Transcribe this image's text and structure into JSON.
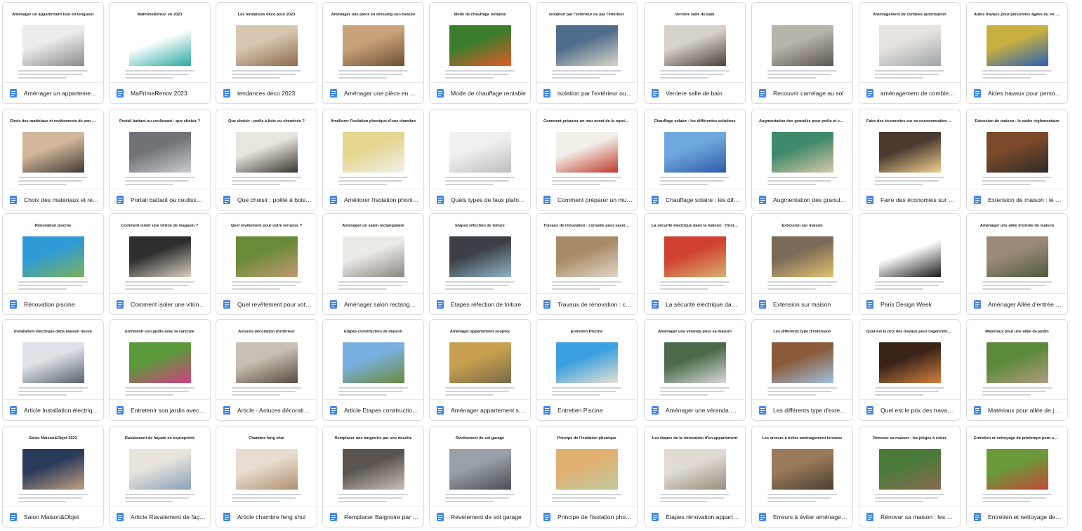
{
  "documents": [
    {
      "name": "Aménager un appartement t...",
      "preview_title": "Aménager un appartement tout en longueur",
      "colors": [
        "#ececec",
        "#8a8a8a"
      ]
    },
    {
      "name": "MaPrimeRenov 2023",
      "preview_title": "MaPrimeRénov' en 2023",
      "colors": [
        "#ffffff",
        "#2aa8a0"
      ]
    },
    {
      "name": "tendances deco 2023",
      "preview_title": "Les tendances déco pour 2023",
      "colors": [
        "#d8c7b0",
        "#8b6b4e"
      ]
    },
    {
      "name": "Aménager une pièce en dres...",
      "preview_title": "Aménager une pièce en dressing sur-mesure",
      "colors": [
        "#c9a27a",
        "#6e4f34"
      ]
    },
    {
      "name": "Mode de chauffage rentable",
      "preview_title": "Mode de chauffage rentable",
      "colors": [
        "#3a7d2c",
        "#e25b2a"
      ]
    },
    {
      "name": "isolation par l'extérieur ou pa...",
      "preview_title": "Isolation par l'extérieur ou par l'intérieur",
      "colors": [
        "#4f6d8a",
        "#d9d4c8"
      ]
    },
    {
      "name": "Verriere salle de bain",
      "preview_title": "Verrière salle de bain",
      "colors": [
        "#d7d2cb",
        "#4a4038"
      ]
    },
    {
      "name": "Recouvrir carrelage au sol",
      "preview_title": "",
      "colors": [
        "#b8b3ab",
        "#5c5650"
      ]
    },
    {
      "name": "aménagement de combles a...",
      "preview_title": "Aménagement de combles autorisation",
      "colors": [
        "#e6e3de",
        "#9ea3a8"
      ]
    },
    {
      "name": "Aides travaux pour personne...",
      "preview_title": "Aides travaux pour personnes âgées ou en situation de handicap",
      "colors": [
        "#c8b040",
        "#2a5fb0"
      ]
    },
    {
      "name": "Choix des matériaux et revêt...",
      "preview_title": "Choix des matériaux et revêtements de son escalier",
      "colors": [
        "#d2b89a",
        "#403a36"
      ]
    },
    {
      "name": "Portail battant ou coulissant ...",
      "preview_title": "Portail battant ou coulissant : que choisir ?",
      "colors": [
        "#6f7378",
        "#c9ccd0"
      ]
    },
    {
      "name": "Que choisir : poêle à bois ou ...",
      "preview_title": "Que choisir : poêle à bois ou cheminée ?",
      "colors": [
        "#e8e4de",
        "#3b3430"
      ]
    },
    {
      "name": "Améliorer l'isolation phoniqu...",
      "preview_title": "Améliorer l'isolation phonique d'une chambre",
      "colors": [
        "#e4d690",
        "#f2f0ea"
      ]
    },
    {
      "name": "Quels types de faux plafond ...",
      "preview_title": "",
      "colors": [
        "#f0f0f0",
        "#bdbdbd"
      ]
    },
    {
      "name": "Comment préparer un mur a...",
      "preview_title": "Comment préparer un mur avant de le repeindre ?",
      "colors": [
        "#f2efe9",
        "#c0392b"
      ]
    },
    {
      "name": "Chauffage solaire : les différ...",
      "preview_title": "Chauffage solaire : les différentes solutions",
      "colors": [
        "#6fa8dc",
        "#2e5aa8"
      ]
    },
    {
      "name": "Augmentation des granulés ...",
      "preview_title": "Augmentation des granulés pour poêle et chaudière",
      "colors": [
        "#3f8a6a",
        "#d9c8a8"
      ]
    },
    {
      "name": "Faire des économies sur sa c...",
      "preview_title": "Faire des économies sur sa consommation électrique",
      "colors": [
        "#4a3a30",
        "#f0d090"
      ]
    },
    {
      "name": "Extension de maison : le cad...",
      "preview_title": "Extension de maison : le cadre réglementaire",
      "colors": [
        "#7a4a2a",
        "#2e2a28"
      ]
    },
    {
      "name": "Rénovation piscine",
      "preview_title": "Rénovation piscine",
      "colors": [
        "#2f9ad6",
        "#7bb35a"
      ]
    },
    {
      "name": "Comment isoler une vitrine d...",
      "preview_title": "Comment isoler une vitrine de magasin ?",
      "colors": [
        "#2e2e2e",
        "#d8d0c0"
      ]
    },
    {
      "name": "Quel revêtement pour votre t...",
      "preview_title": "Quel revêtement pour votre terrasse ?",
      "colors": [
        "#6a8a3a",
        "#c09a70"
      ]
    },
    {
      "name": "Aménager salon rectangulaire",
      "preview_title": "Aménager un salon rectangulaire",
      "colors": [
        "#ecebe8",
        "#8c8680"
      ]
    },
    {
      "name": "Etapes réfection de toiture",
      "preview_title": "Étapes réfection de toiture",
      "colors": [
        "#3c4046",
        "#8fb3c8"
      ]
    },
    {
      "name": "Travaux de rénovation : cons...",
      "preview_title": "Travaux de rénovation : conseils pour savoir par quoi commencer",
      "colors": [
        "#a88a66",
        "#e0d6c8"
      ]
    },
    {
      "name": "La sécurité électrique dans l...",
      "preview_title": "La sécurité électrique dans la maison : l'installation électrique",
      "colors": [
        "#d04030",
        "#d8b070"
      ]
    },
    {
      "name": "Extension sur maison",
      "preview_title": "Extension sur maison",
      "colors": [
        "#7a6a58",
        "#e0c070"
      ]
    },
    {
      "name": "Paris Design Week",
      "preview_title": "",
      "colors": [
        "#ffffff",
        "#1a1a1a"
      ]
    },
    {
      "name": "Aménager Allée d'entrée de ...",
      "preview_title": "Aménager une allée d'entrée de maison",
      "colors": [
        "#9a8a78",
        "#4e5a3a"
      ]
    },
    {
      "name": "Article Installation électrique...",
      "preview_title": "Installation électrique dans maison neuve",
      "colors": [
        "#dfe3e8",
        "#5a6270"
      ]
    },
    {
      "name": "Entretenir son jardin avec la ...",
      "preview_title": "Entretenir son jardin avec la canicule",
      "colors": [
        "#5a9a3a",
        "#d04080"
      ]
    },
    {
      "name": "Article - Astuces décoration ...",
      "preview_title": "Astuces décoration d'intérieur",
      "colors": [
        "#c8c0b4",
        "#5a4a3e"
      ]
    },
    {
      "name": "Article Etapes construction d...",
      "preview_title": "Étapes construction de maison",
      "colors": [
        "#7ab0e0",
        "#6a8a3a"
      ]
    },
    {
      "name": "Aménager appartement sou...",
      "preview_title": "Aménager appartement souplex",
      "colors": [
        "#c8a050",
        "#7a6a48"
      ]
    },
    {
      "name": "Entretien Piscine",
      "preview_title": "Entretien Piscine",
      "colors": [
        "#3aa0e0",
        "#e8e0d0"
      ]
    },
    {
      "name": "Aménager une véranda mais...",
      "preview_title": "Aménager une véranda pour sa maison",
      "colors": [
        "#4a6a4a",
        "#d8d8d8"
      ]
    },
    {
      "name": "Les différents type d'extension",
      "preview_title": "Les différents type d'extension",
      "colors": [
        "#8a5a3a",
        "#a0c0e0"
      ]
    },
    {
      "name": "Quel est le prix des travaux p...",
      "preview_title": "Quel est le prix des travaux pour l'agencement d'un restaurant ?",
      "colors": [
        "#3a2418",
        "#d08040"
      ]
    },
    {
      "name": "Matériaux pour allée de jardin",
      "preview_title": "Matériaux pour une allée de jardin",
      "colors": [
        "#5a8a3a",
        "#b09a80"
      ]
    },
    {
      "name": "Salon Maison&Objet",
      "preview_title": "Salon Maison&Objet 2023",
      "colors": [
        "#2a3a5a",
        "#c0a080"
      ]
    },
    {
      "name": "Article Ravalement de façad...",
      "preview_title": "Ravalement de façade en copropriété",
      "colors": [
        "#e8e4dc",
        "#8aa0b8"
      ]
    },
    {
      "name": "Article chambre feng shui",
      "preview_title": "Chambre feng shui",
      "colors": [
        "#e8ddd0",
        "#b09070"
      ]
    },
    {
      "name": "Remplacer Baignoire par une...",
      "preview_title": "Remplacer une baignoire par une douche",
      "colors": [
        "#5a5450",
        "#c8c0b8"
      ]
    },
    {
      "name": "Revetement de sol garage",
      "preview_title": "Revêtement de sol garage",
      "colors": [
        "#9aa0a8",
        "#4a4e54"
      ]
    },
    {
      "name": "Principe de l'isolation phoniq...",
      "preview_title": "Principe de l'isolation phonique",
      "colors": [
        "#e0b070",
        "#c0c8a0"
      ]
    },
    {
      "name": "Étapes rénovation appartem...",
      "preview_title": "Les étapes de la rénovation d'un appartement",
      "colors": [
        "#e0dcd4",
        "#9a8e80"
      ]
    },
    {
      "name": "Erreurs à éviter aménageme...",
      "preview_title": "Les erreurs à éviter aménagement terrasse",
      "colors": [
        "#9a7a5a",
        "#4a3e30"
      ]
    },
    {
      "name": "Rénover sa maison : les pièg...",
      "preview_title": "Rénover sa maison : les pièges à éviter",
      "colors": [
        "#4a7a3a",
        "#8a6a50"
      ]
    },
    {
      "name": "Entretien et nettoyage de pri...",
      "preview_title": "Entretien et nettoyage de printemps pour son jardin",
      "colors": [
        "#6a9a3a",
        "#c04a3a"
      ]
    }
  ]
}
